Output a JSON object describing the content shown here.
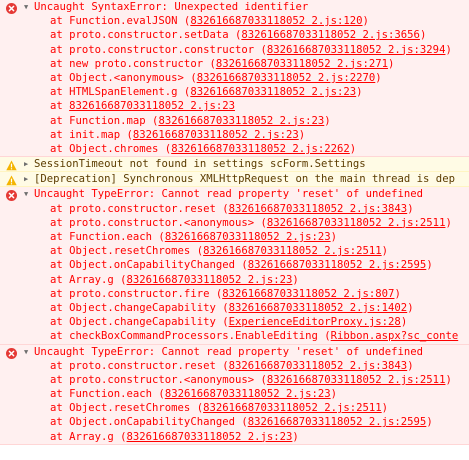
{
  "entries": [
    {
      "level": "error",
      "expanded": true,
      "message": "Uncaught SyntaxError: Unexpected identifier",
      "frames": [
        {
          "prefix": "at Function.evalJSON (",
          "link": "832616687033118052 2.js:120",
          "suffix": ")"
        },
        {
          "prefix": "at proto.constructor.setData (",
          "link": "832616687033118052 2.js:3656",
          "suffix": ")"
        },
        {
          "prefix": "at proto.constructor.constructor (",
          "link": "832616687033118052 2.js:3294",
          "suffix": ")"
        },
        {
          "prefix": "at new proto.constructor (",
          "link": "832616687033118052 2.js:271",
          "suffix": ")"
        },
        {
          "prefix": "at Object.<anonymous> (",
          "link": "832616687033118052 2.js:2270",
          "suffix": ")"
        },
        {
          "prefix": "at HTMLSpanElement.g (",
          "link": "832616687033118052 2.js:23",
          "suffix": ")"
        },
        {
          "prefix": "at ",
          "link": "832616687033118052 2.js:23",
          "suffix": ""
        },
        {
          "prefix": "at Function.map (",
          "link": "832616687033118052 2.js:23",
          "suffix": ")"
        },
        {
          "prefix": "at init.map (",
          "link": "832616687033118052 2.js:23",
          "suffix": ")"
        },
        {
          "prefix": "at Object.chromes (",
          "link": "832616687033118052 2.js:2262",
          "suffix": ")"
        }
      ]
    },
    {
      "level": "warning",
      "expanded": false,
      "message": "SessionTimeout not found in settings scForm.Settings",
      "frames": []
    },
    {
      "level": "warning",
      "expanded": false,
      "message": "[Deprecation] Synchronous XMLHttpRequest on the main thread is dep",
      "frames": []
    },
    {
      "level": "error",
      "expanded": true,
      "message": "Uncaught TypeError: Cannot read property 'reset' of undefined",
      "frames": [
        {
          "prefix": "at proto.constructor.reset (",
          "link": "832616687033118052 2.js:3843",
          "suffix": ")"
        },
        {
          "prefix": "at proto.constructor.<anonymous> (",
          "link": "832616687033118052 2.js:2511",
          "suffix": ")"
        },
        {
          "prefix": "at Function.each (",
          "link": "832616687033118052 2.js:23",
          "suffix": ")"
        },
        {
          "prefix": "at Object.resetChromes (",
          "link": "832616687033118052 2.js:2511",
          "suffix": ")"
        },
        {
          "prefix": "at Object.onCapabilityChanged (",
          "link": "832616687033118052 2.js:2595",
          "suffix": ")"
        },
        {
          "prefix": "at Array.g (",
          "link": "832616687033118052 2.js:23",
          "suffix": ")"
        },
        {
          "prefix": "at proto.constructor.fire (",
          "link": "832616687033118052 2.js:807",
          "suffix": ")"
        },
        {
          "prefix": "at Object.changeCapability (",
          "link": "832616687033118052 2.js:1402",
          "suffix": ")"
        },
        {
          "prefix": "at Object.changeCapability (",
          "link": "ExperienceEditorProxy.js:28",
          "suffix": ")"
        },
        {
          "prefix": "at checkBoxCommandProcessors.EnableEditing (",
          "link": "Ribbon.aspx?sc_conte",
          "suffix": ""
        }
      ]
    },
    {
      "level": "error",
      "expanded": true,
      "message": "Uncaught TypeError: Cannot read property 'reset' of undefined",
      "frames": [
        {
          "prefix": "at proto.constructor.reset (",
          "link": "832616687033118052 2.js:3843",
          "suffix": ")"
        },
        {
          "prefix": "at proto.constructor.<anonymous> (",
          "link": "832616687033118052 2.js:2511",
          "suffix": ")"
        },
        {
          "prefix": "at Function.each (",
          "link": "832616687033118052 2.js:23",
          "suffix": ")"
        },
        {
          "prefix": "at Object.resetChromes (",
          "link": "832616687033118052 2.js:2511",
          "suffix": ")"
        },
        {
          "prefix": "at Object.onCapabilityChanged (",
          "link": "832616687033118052 2.js:2595",
          "suffix": ")"
        },
        {
          "prefix": "at Array.g (",
          "link": "832616687033118052 2.js:23",
          "suffix": ")"
        }
      ]
    }
  ],
  "icons": {
    "error": "error-circle-icon",
    "warning": "warning-triangle-icon",
    "expanded": "triangle-down-icon",
    "collapsed": "triangle-right-icon"
  },
  "colors": {
    "error_text": "#ff0000",
    "error_bg": "#fff0f0",
    "warning_text": "#5c3c00",
    "warning_bg": "#fffbe5"
  }
}
